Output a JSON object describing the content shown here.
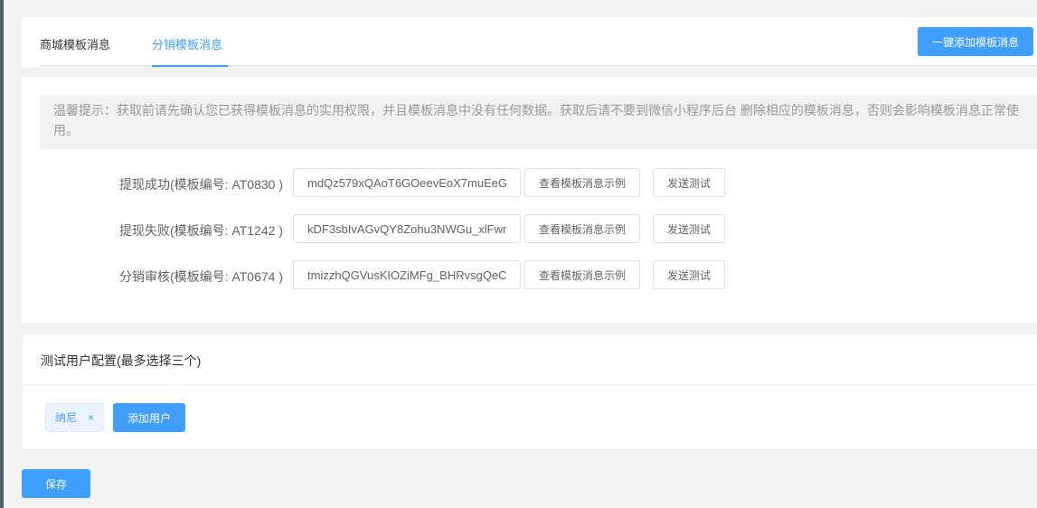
{
  "tabs": [
    {
      "label": "商城模板消息"
    },
    {
      "label": "分销模板消息"
    }
  ],
  "add_all_label": "一键添加模板消息",
  "tip": "温馨提示：获取前请先确认您已获得模板消息的实用权限，并且模板消息中没有任何数据。获取后请不要到微信小程序后台 删除相应的模板消息，否则会影响模板消息正常使用。",
  "templates": [
    {
      "label": "提现成功(模板编号: AT0830 )",
      "value": "mdQz579xQAoT6GOeevEoX7muEeG",
      "view_label": "查看模板消息示例",
      "test_label": "发送测试"
    },
    {
      "label": "提现失败(模板编号: AT1242 )",
      "value": "kDF3sbIvAGvQY8Zohu3NWGu_xlFwr",
      "view_label": "查看模板消息示例",
      "test_label": "发送测试"
    },
    {
      "label": "分销审核(模板编号: AT0674 )",
      "value": "tmizzhQGVusKIOZiMFg_BHRvsgQeC",
      "view_label": "查看模板消息示例",
      "test_label": "发送测试"
    }
  ],
  "test_users": {
    "title": "测试用户配置(最多选择三个)",
    "users": [
      {
        "name": "纳尼"
      }
    ],
    "close_icon": "×",
    "add_label": "添加用户"
  },
  "save_label": "保存"
}
